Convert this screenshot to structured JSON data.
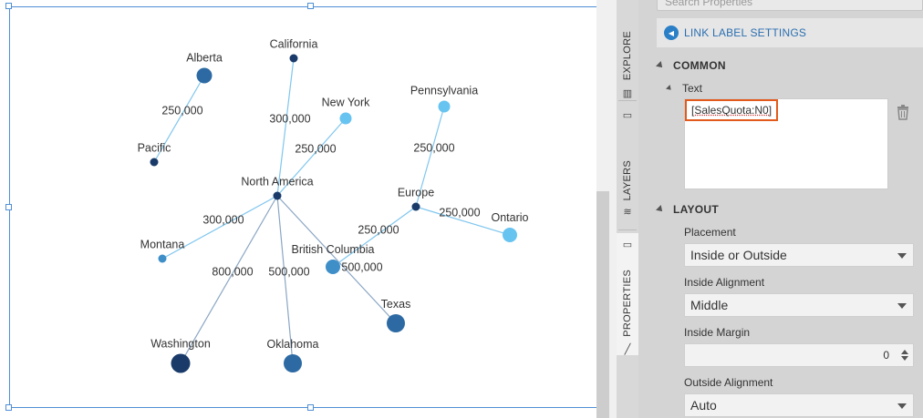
{
  "canvas": {
    "nodes": [
      {
        "id": "alberta",
        "label": "Alberta",
        "color": "#2d6aa3"
      },
      {
        "id": "pacific",
        "label": "Pacific",
        "color": "#1a3b6a"
      },
      {
        "id": "california",
        "label": "California",
        "color": "#1a3b6a"
      },
      {
        "id": "newyork",
        "label": "New York",
        "color": "#67c3f0"
      },
      {
        "id": "pennsylvania",
        "label": "Pennsylvania",
        "color": "#67c3f0"
      },
      {
        "id": "northamerica",
        "label": "North America",
        "color": "#1a3b6a"
      },
      {
        "id": "europe",
        "label": "Europe",
        "color": "#1a3b6a"
      },
      {
        "id": "ontario",
        "label": "Ontario",
        "color": "#67c3f0"
      },
      {
        "id": "montana",
        "label": "Montana",
        "color": "#3e8ec8"
      },
      {
        "id": "britishcolumbia",
        "label": "British Columbia",
        "color": "#3e8ec8"
      },
      {
        "id": "texas",
        "label": "Texas",
        "color": "#2d6aa3"
      },
      {
        "id": "washington",
        "label": "Washington",
        "color": "#1a3b6a"
      },
      {
        "id": "oklahoma",
        "label": "Oklahoma",
        "color": "#2d6aa3"
      }
    ],
    "links": [
      {
        "from": "alberta",
        "to": "pacific",
        "label": "250,000",
        "color": "#7fc6ee"
      },
      {
        "from": "northamerica",
        "to": "california",
        "label": "300,000",
        "color": "#7fc6ee"
      },
      {
        "from": "northamerica",
        "to": "newyork",
        "label": "250,000",
        "color": "#7fc6ee"
      },
      {
        "from": "northamerica",
        "to": "montana",
        "label": "300,000",
        "color": "#7fc6ee"
      },
      {
        "from": "northamerica",
        "to": "washington",
        "label": "800,000",
        "color": "#8aa6c4"
      },
      {
        "from": "northamerica",
        "to": "oklahoma",
        "label": "500,000",
        "color": "#8aa6c4"
      },
      {
        "from": "northamerica",
        "to": "texas",
        "label": "",
        "color": "#8aa6c4"
      },
      {
        "from": "europe",
        "to": "pennsylvania",
        "label": "250,000",
        "color": "#7fc6ee"
      },
      {
        "from": "europe",
        "to": "ontario",
        "label": "250,000",
        "color": "#7fc6ee"
      },
      {
        "from": "europe",
        "to": "britishcolumbia",
        "label": "250,000",
        "color": "#7fc6ee"
      },
      {
        "from": "",
        "to": "",
        "label": "500,000",
        "color": ""
      }
    ]
  },
  "tabs": {
    "explore": "EXPLORE",
    "layers": "LAYERS",
    "properties": "PROPERTIES"
  },
  "panel": {
    "search_placeholder": "Search Properties",
    "back_label": "LINK LABEL SETTINGS",
    "common_header": "COMMON",
    "text_label": "Text",
    "text_value": "[SalesQuota:N0]",
    "layout_header": "LAYOUT",
    "placement_label": "Placement",
    "placement_value": "Inside or Outside",
    "inside_alignment_label": "Inside Alignment",
    "inside_alignment_value": "Middle",
    "inside_margin_label": "Inside Margin",
    "inside_margin_value": "0",
    "outside_alignment_label": "Outside Alignment",
    "outside_alignment_value": "Auto"
  },
  "colors": {
    "accent": "#2b7fc6",
    "highlight": "#e25a1c",
    "selection": "#4f8fd6"
  }
}
